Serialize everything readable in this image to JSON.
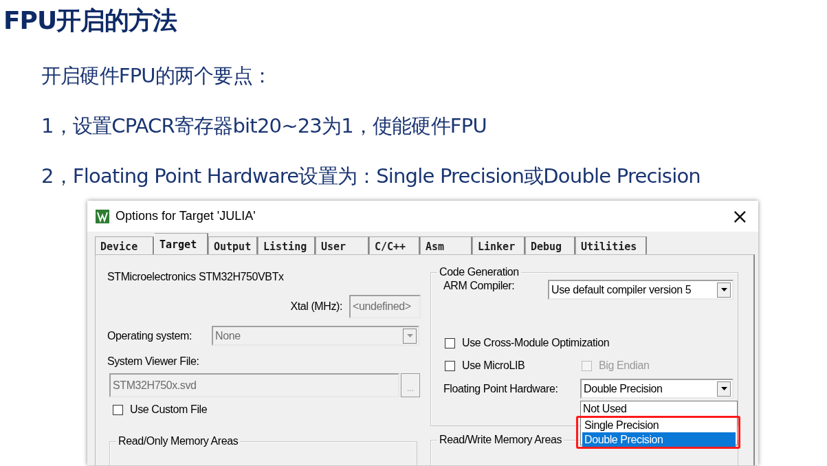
{
  "slide": {
    "title": "FPU开启的方法",
    "points": [
      "开启硬件FPU的两个要点：",
      "1，设置CPACR寄存器bit20~23为1，使能硬件FPU",
      "2，Floating Point Hardware设置为：Single Precision或Double Precision"
    ]
  },
  "dialog": {
    "title": "Options for Target 'JULIA'",
    "close": "×",
    "tabs": [
      {
        "label": "Device",
        "selected": false
      },
      {
        "label": "Target",
        "selected": true
      },
      {
        "label": "Output",
        "selected": false
      },
      {
        "label": "Listing",
        "selected": false
      },
      {
        "label": "User",
        "selected": false
      },
      {
        "label": "C/C++",
        "selected": false
      },
      {
        "label": "Asm",
        "selected": false
      },
      {
        "label": "Linker",
        "selected": false
      },
      {
        "label": "Debug",
        "selected": false
      },
      {
        "label": "Utilities",
        "selected": false
      }
    ],
    "device": "STMicroelectronics STM32H750VBTx",
    "xtal": {
      "label": "Xtal (MHz):",
      "value": "<undefined>",
      "disabled": true
    },
    "operating_system": {
      "label": "Operating system:",
      "value": "None",
      "disabled": true
    },
    "system_viewer_file": {
      "label": "System Viewer File:",
      "value": "STM32H750x.svd",
      "disabled": true,
      "browse": "..."
    },
    "use_custom_file": {
      "label": "Use Custom File",
      "checked": false
    },
    "read_only_memory": {
      "title": "Read/Only Memory Areas"
    },
    "code_generation": {
      "title": "Code Generation",
      "arm_compiler": {
        "label": "ARM Compiler:",
        "value": "Use default compiler version 5"
      },
      "options": [
        {
          "label": "Use Cross-Module Optimization",
          "checked": false,
          "disabled": false
        },
        {
          "label": "Use MicroLIB",
          "checked": false,
          "disabled": false
        },
        {
          "label": "Big Endian",
          "checked": false,
          "disabled": true
        }
      ],
      "floating_point_hardware": {
        "label": "Floating Point Hardware:",
        "value": "Double Precision",
        "list": [
          {
            "label": "Not Used",
            "selected": false,
            "marked": false
          },
          {
            "label": "Single Precision",
            "selected": false,
            "marked": true
          },
          {
            "label": "Double Precision",
            "selected": true,
            "marked": true
          }
        ]
      }
    },
    "read_write_memory": {
      "title": "Read/Write Memory Areas"
    }
  }
}
